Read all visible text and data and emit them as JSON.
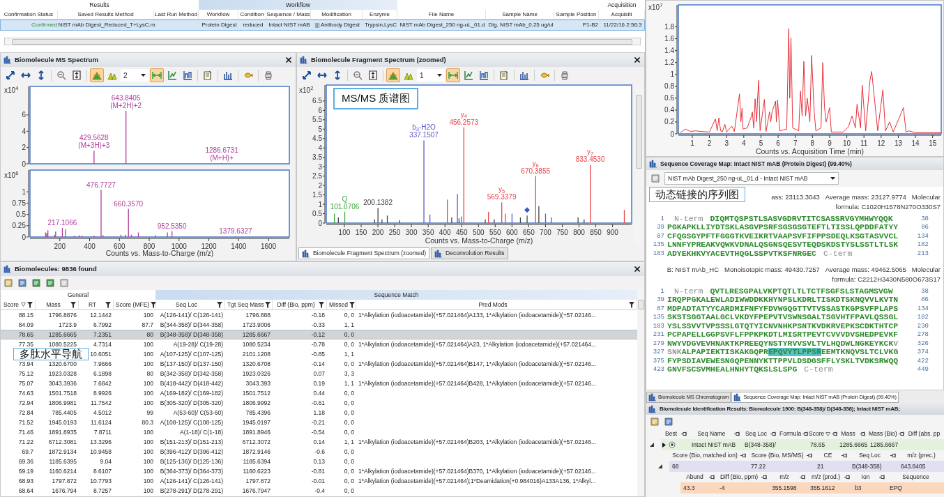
{
  "results_grid": {
    "groups": [
      {
        "label": "Results",
        "kind": "plain"
      },
      {
        "label": "Workflow",
        "kind": "band"
      },
      {
        "label": "Acquisition",
        "kind": "plain"
      }
    ],
    "columns": [
      "Confirmation Status",
      "Saved Results Method",
      "Last Run Method",
      "Workflow",
      "Condition",
      "Sequence / Mass",
      "Modification",
      "Enzyme",
      "File Name",
      "Sample Name",
      "Sample Position",
      "Acquisiti"
    ],
    "rows": [
      {
        "selected": true,
        "cells": [
          "Confirmed",
          "NIST mAb Digest_Reduced_T+LysC.m",
          null,
          "Protein Digest",
          "reduced",
          "Intact NIST mAB",
          "||| Antibody Digest",
          "Trypsin,LysC",
          "NIST mAb Digest_250 ng-uL_01.d",
          "Dig. NIST mAb_0.25 ug/ul",
          "P1-B2",
          "11/22/16 2:56:3"
        ]
      }
    ]
  },
  "ms_panel": {
    "title": "Biomolecule MS Spectrum",
    "toolbar": {
      "buttons": [
        {
          "selected": false
        },
        {
          "selected": false
        },
        {
          "selected": false
        },
        {
          "selected": false
        },
        {
          "selected": false
        },
        {
          "selected": true
        },
        {
          "selected": false
        },
        {
          "selected": true
        },
        {
          "selected": false
        },
        {
          "selected": false
        },
        {
          "selected": false
        },
        {
          "selected": false
        },
        {
          "selected": false
        },
        {
          "selected": false
        }
      ],
      "dropdown": "2"
    },
    "charts": [
      {
        "chart_data": {
          "type": "bar",
          "ylabel": "x10$^{4}$",
          "xlim": [
            0,
            1740
          ],
          "ylim": [
            0,
            9.5
          ],
          "yticks": [
            0,
            2,
            4,
            6
          ],
          "x": [
            429.5628,
            643.8405,
            1286.6731
          ],
          "series": [
            {
              "color": "#b03c9c",
              "values": [
                1.6,
                6.5,
                0.1
              ]
            }
          ],
          "annotations": [
            {
              "x": 643.8405,
              "y": 6.5,
              "text": "643.8405"
            },
            {
              "x": 643.8405,
              "y": 6.5,
              "text": "(M+2H)+2"
            },
            {
              "x": 429.5628,
              "y": 1.6,
              "text": "429.5628"
            },
            {
              "x": 429.5628,
              "y": 1.6,
              "text": "(M+3H)+3"
            },
            {
              "x": 1286.6731,
              "y": 0.1,
              "text": "1286.6731"
            },
            {
              "x": 1286.6731,
              "y": 0.1,
              "text": "(M+H)+"
            }
          ]
        }
      },
      {
        "chart_data": {
          "type": "bar",
          "ylabel": "x10$^{6}$",
          "xlabel": "Counts vs. Mass-to-Charge (m/z)",
          "xlim": [
            0,
            1740
          ],
          "ylim": [
            0,
            1.48
          ],
          "yticks": [
            0,
            0.25,
            0.5,
            0.75,
            1
          ],
          "xticks": [
            200,
            400,
            600,
            800,
            1000,
            1200,
            1400,
            1600
          ],
          "x": [
            105,
            112,
            120,
            165,
            172,
            217.1066,
            238,
            300,
            330,
            350,
            400,
            430,
            476.7727,
            490,
            520,
            610,
            640,
            660.357,
            680,
            727,
            760,
            840,
            922,
            952.535,
            1379.6327
          ],
          "series": [
            {
              "color": "#b03c9c",
              "values": [
                0.1,
                0.08,
                0.15,
                0.05,
                0.12,
                0.2,
                0.17,
                0.03,
                0.04,
                0.03,
                null,
                0.03,
                1.04,
                0.04,
                null,
                0.05,
                0.05,
                0.62,
                0.05,
                0.1,
                null,
                0.04,
                0.1,
                0.13,
                0.01
              ]
            }
          ],
          "annotations": [
            {
              "x": 476.7727,
              "y": 1.04,
              "text": "476.7727"
            },
            {
              "x": 660.357,
              "y": 0.62,
              "text": "660.3570"
            },
            {
              "x": 217.1066,
              "y": 0.2,
              "text": "217.1066"
            },
            {
              "x": 952.535,
              "y": 0.13,
              "text": "952.5350"
            },
            {
              "x": 1379.6327,
              "y": 0.01,
              "text": "1379.6327"
            }
          ]
        }
      }
    ]
  },
  "fragment_panel": {
    "title": "Biomolecule Fragment Spectrum (zoomed)",
    "toolbar": {
      "buttons": [
        {
          "selected": false
        },
        {
          "selected": false
        },
        {
          "selected": false
        },
        {
          "selected": false
        },
        {
          "selected": false
        },
        {
          "selected": true
        },
        {
          "selected": false
        },
        {
          "selected": true
        },
        {
          "selected": false
        },
        {
          "selected": false
        },
        {
          "selected": false
        },
        {
          "selected": false
        },
        {
          "selected": false
        },
        {
          "selected": false
        }
      ],
      "dropdown": "1"
    },
    "callout": "MS/MS 质谱图",
    "chart_data": {
      "type": "bar",
      "ylabel": "x10$^{2}$",
      "xlabel": "Counts vs. Mass-to-Charge (m/z)",
      "xlim": [
        46,
        957
      ],
      "ylim": [
        0,
        7.35
      ],
      "yticks": [
        0,
        0.5,
        1,
        1.5,
        2,
        2.5,
        3,
        3.5,
        4,
        4.5,
        5,
        5.5,
        6,
        6.5
      ],
      "xticks": [
        100,
        150,
        200,
        250,
        300,
        350,
        400,
        450,
        500,
        550,
        600,
        650,
        700,
        750,
        800,
        850,
        900
      ],
      "series": [
        {
          "color": "#3aa63a",
          "x": [
            70,
            101.0706
          ],
          "values": [
            0.5,
            0.6
          ]
        },
        {
          "color": "#444444",
          "x": [
            82,
            190,
            200.1382,
            212,
            228,
            265,
            420,
            442,
            520,
            547,
            625,
            645,
            680,
            797,
            815
          ],
          "values": [
            0.3,
            0.2,
            0.8,
            0.2,
            0.4,
            0.15,
            0.3,
            0.25,
            0.2,
            0.2,
            0.3,
            0.4,
            0.9,
            0.3,
            0.2
          ]
        },
        {
          "color": "#5b5bc8",
          "x": [
            337.1507,
            355,
            437,
            449,
            600,
            700,
            717
          ],
          "values": [
            4.4,
            0.45,
            1.55,
            0.35,
            0.5,
            0.5,
            0.3
          ]
        },
        {
          "color": "#e8434a",
          "x": [
            407,
            456.2573,
            530,
            569.3379,
            580,
            670.3855,
            833.453,
            935
          ],
          "values": [
            1.25,
            5.1,
            0.6,
            1.1,
            0.5,
            2.5,
            3.1,
            0.7
          ]
        }
      ],
      "annotations": [
        {
          "x": 101.0706,
          "y": 0.6,
          "text": "Q"
        },
        {
          "x": 101.0706,
          "y": 0.6,
          "text": "101.0706"
        },
        {
          "x": 200.1382,
          "y": 0.8,
          "text": "200.1382"
        },
        {
          "x": 337.1507,
          "y": 4.4,
          "text": "b$_{3}$-H2O"
        },
        {
          "x": 337.1507,
          "y": 4.4,
          "text": "337.1507"
        },
        {
          "x": 456.2573,
          "y": 5.1,
          "text": "y$_{4}$"
        },
        {
          "x": 456.2573,
          "y": 5.1,
          "text": "456.2573"
        },
        {
          "x": 569.3379,
          "y": 1.1,
          "text": "y$_{5}$"
        },
        {
          "x": 569.3379,
          "y": 1.1,
          "text": "569.3379"
        },
        {
          "x": 670.3855,
          "y": 2.5,
          "text": "y$_{6}$"
        },
        {
          "x": 670.3855,
          "y": 2.5,
          "text": "670.3855"
        },
        {
          "x": 833.453,
          "y": 3.1,
          "text": "y$_{7}$"
        },
        {
          "x": 833.453,
          "y": 3.1,
          "text": "833.4530"
        }
      ]
    },
    "tabs": [
      {
        "label": "Biomolecule Fragment Spectrum (zoomed)",
        "selected": true
      },
      {
        "label": "Deconvolution Results",
        "selected": false
      }
    ]
  },
  "biomolecules": {
    "title": "Biomolecules: 9836 found",
    "callout": "多肽水平导航",
    "groups": [
      {
        "label": "General",
        "kind": "plain"
      },
      {
        "label": "Sequence Match",
        "kind": "band"
      }
    ],
    "columns": [
      {
        "label": "Score",
        "sorted": true
      },
      {
        "label": "Mass",
        "sorted": false
      },
      {
        "label": "RT",
        "sorted": false
      },
      {
        "label": "Score (MFE)",
        "sorted": false
      },
      {
        "label": "Seq Loc",
        "sorted": false
      },
      {
        "label": "Tgt Seq Mass",
        "sorted": false
      },
      {
        "label": "Diff (Bio, ppm)",
        "sorted": false
      },
      {
        "label": "Missed",
        "sorted": false
      },
      {
        "label": "Pred Mods",
        "sorted": false
      }
    ],
    "rows": [
      {
        "selected": false,
        "cells": [
          "88.15",
          "1796.8876",
          "12.1442",
          "100",
          "A(126-141)/ C(126-141)",
          "1796.888",
          "-0.18",
          "0, 0",
          "1*Alkylation (iodoacetamide)(+57.021464)A133, 1*Alkylation (iodoacetamide)(+57.02146..."
        ]
      },
      {
        "selected": false,
        "cells": [
          "84.09",
          "1723.9",
          "6.7992",
          "87.7",
          "B(344-358)/ D(344-358)",
          "1723.9006",
          "-0.33",
          "1, 1",
          null
        ]
      },
      {
        "selected": true,
        "cells": [
          "78.65",
          "1285.6665",
          "7.2351",
          "80",
          "B(348-358)/ D(348-358)",
          "1285.6667",
          "-0.12",
          "0, 0",
          null
        ]
      },
      {
        "selected": false,
        "cells": [
          "77.35",
          "1080.5225",
          "4.7314",
          "100",
          "A(19-28)/ C(19-28)",
          "1080.5234",
          "-0.78",
          "0, 0",
          "1*Alkylation (iodoacetamide)(+57.021464)A23, 1*Alkylation (iodoacetamide)(+57.021464..."
        ]
      },
      {
        "selected": false,
        "cells": [
          null,
          null,
          "10.6051",
          "100",
          "A(107-125)/ C(107-125)",
          "2101.1208",
          "-0.85",
          "1, 1",
          null
        ]
      },
      {
        "selected": false,
        "cells": [
          "73.94",
          "1320.6700",
          "7.9666",
          "100",
          "B(137-150)/ D(137-150)",
          "1320.6708",
          "-0.14",
          "0, 0",
          "1*Alkylation (iodoacetamide)(+57.021464)B147, 1*Alkylation (iodoacetamide)(+57.02146..."
        ]
      },
      {
        "selected": false,
        "cells": [
          "75.12",
          "1923.0328",
          "6.1898",
          "80",
          "B(342-358)/ D(342-358)",
          "1923.0326",
          "0.07",
          "3, 3",
          null
        ]
      },
      {
        "selected": false,
        "cells": [
          "75.07",
          "3043.3936",
          "7.6842",
          "100",
          "B(418-442)/ D(418-442)",
          "3043.393",
          "0.19",
          "1, 1",
          "1*Alkylation (iodoacetamide)(+57.021464)B428, 1*Alkylation (iodoacetamide)(+57.02146..."
        ]
      },
      {
        "selected": false,
        "cells": [
          "74.63",
          "1501.7518",
          "8.9926",
          "100",
          "A(169-182)/ C(169-182)",
          "1501.7512",
          "0.44",
          "0, 0",
          null
        ]
      },
      {
        "selected": false,
        "cells": [
          "72.94",
          "1806.9981",
          "11.7542",
          "100",
          "B(305-320)/ D(305-320)",
          "1806.9992",
          "-0.61",
          "0, 0",
          null
        ]
      },
      {
        "selected": false,
        "cells": [
          "72.84",
          "785.4405",
          "4.5012",
          "99",
          "A(53-60)/ C(53-60)",
          "785.4396",
          "1.18",
          "0, 0",
          null
        ]
      },
      {
        "selected": false,
        "cells": [
          "71.52",
          "1945.0193",
          "11.6124",
          "80.3",
          "A(108-125)/ C(108-125)",
          "1945.0197",
          "-0.21",
          "0, 0",
          null
        ]
      },
      {
        "selected": false,
        "cells": [
          "71.46",
          "1891.8935",
          "7.8711",
          "100",
          "A(1-18)/ C(1-18)",
          "1891.8946",
          "-0.54",
          "0, 0",
          null
        ]
      },
      {
        "selected": false,
        "cells": [
          "71.22",
          "6712.3081",
          "13.3296",
          "100",
          "B(151-213)/ D(151-213)",
          "6712.3072",
          "0.14",
          "1, 1",
          "1*Alkylation (iodoacetamide)(+57.021464)B203, 1*Alkylation (iodoacetamide)(+57.02146..."
        ]
      },
      {
        "selected": false,
        "cells": [
          "69.7",
          "1872.9134",
          "10.9458",
          "100",
          "B(396-412)/ D(396-412)",
          "1872.9146",
          "-0.6",
          "0, 0",
          null
        ]
      },
      {
        "selected": false,
        "cells": [
          "69.36",
          "1185.6395",
          "9.04",
          "100",
          "B(125-136)/ D(125-136)",
          "1185.6394",
          "0.13",
          "0, 0",
          null
        ]
      },
      {
        "selected": false,
        "cells": [
          "69.19",
          "1160.6214",
          "8.6107",
          "100",
          "B(364-373)/ D(364-373)",
          "1160.6223",
          "-0.81",
          "0, 0",
          "1*Alkylation (iodoacetamide)(+57.021464)B370, 1*Alkylation (iodoacetamide)(+57.02146..."
        ]
      },
      {
        "selected": false,
        "cells": [
          "68.93",
          "1797.872",
          "10.7793",
          "100",
          "A(126-141)/ C(126-141)",
          "1797.872",
          "-0.01",
          "0, 0",
          "1*Alkylation (iodoacetamide)(+57.021464);1*Deamidation(+0.984016)A133A136, 1*Alkyl..."
        ]
      },
      {
        "selected": false,
        "cells": [
          "68.64",
          "1676.794",
          "8.7257",
          "100",
          "B(278-291)/ D(278-291)",
          "1676.7947",
          "-0.4",
          "0, 0",
          null
        ]
      }
    ]
  },
  "chromatogram": {
    "chart_data": {
      "type": "line",
      "ylabel": "x10$^{7}$",
      "xlabel": "Counts vs. Acquisition Time (min)",
      "xlim": [
        0.19,
        15.5
      ],
      "ylim": [
        0,
        2.17
      ],
      "yticks": [
        0,
        0.2,
        0.4,
        0.6,
        0.8,
        1,
        1.2,
        1.4,
        1.6,
        1.8
      ],
      "xticks": [
        1,
        2,
        3,
        4,
        5,
        6,
        7,
        8,
        9,
        10,
        11,
        12,
        13,
        14,
        15
      ],
      "x": [
        0.3,
        0.6,
        0.9,
        1.2,
        1.5,
        2.0,
        2.35,
        2.45,
        2.55,
        2.65,
        2.75,
        2.9,
        3.0,
        3.3,
        3.45,
        3.75,
        3.83,
        3.9,
        3.95,
        4.2,
        4.45,
        4.5,
        4.58,
        4.66,
        4.75,
        4.8,
        4.87,
        4.95,
        5.2,
        5.3,
        5.5,
        5.57,
        5.65,
        5.85,
        5.9,
        5.97,
        6.1,
        6.5,
        6.62,
        6.68,
        6.75,
        6.85,
        7.2,
        7.3,
        7.4,
        7.5,
        7.6,
        7.7,
        7.85,
        7.95,
        8.1,
        8.2,
        8.5,
        8.6,
        8.7,
        8.8,
        9.0,
        9.1,
        9.8,
        10.1,
        10.3,
        10.5,
        10.6,
        10.8,
        10.9,
        11.1,
        11.35,
        11.45,
        11.8,
        12.1,
        12.25,
        12.5,
        12.7,
        13.3,
        13.45,
        13.6,
        14.0,
        15.5
      ],
      "series": [
        {
          "color": "#e8303a",
          "values": [
            0.02,
            0.08,
            0.04,
            0.05,
            0.04,
            0.03,
            0.25,
            0.05,
            0.27,
            0.05,
            0.03,
            0.16,
            0.03,
            0.13,
            0.04,
            0.67,
            0.2,
            0.43,
            0.08,
            0.1,
            0.3,
            0.37,
            0.1,
            0.59,
            0.2,
            0.57,
            0.9,
            0.05,
            0.58,
            0.04,
            0.37,
            0.2,
            0.37,
            0.55,
            0.2,
            0.57,
            0.05,
            0.08,
            1.77,
            0.6,
            1.62,
            0.1,
            0.05,
            0.72,
            0.3,
            1.22,
            0.3,
            0.6,
            0.2,
            1.32,
            0.37,
            0.05,
            0.1,
            1.2,
            0.45,
            0.2,
            0.44,
            0.03,
            0.03,
            0.12,
            0.3,
            0.1,
            0.5,
            0.1,
            0.82,
            0.05,
            0.9,
            1.05,
            0.05,
            0.74,
            0.05,
            0.2,
            0.03,
            0.44,
            0.03,
            0.05,
            0.02,
            0.02
          ]
        }
      ]
    }
  },
  "coverage": {
    "title": "Sequence Coverage Map: Intact NIST mAB (Protein Digest) (99.40%)",
    "dropdown": "NIST mAb Digest_250 ng-uL_01.d - Intact NIST mAB",
    "chains": [
      {
        "callout": "动态链接的序列图",
        "mono_mass": "ass: 23113.3043",
        "average_mass": "Average mass: 23127.9774",
        "molecular": "Molecular",
        "formula": "formula: C1020H1578N270O330S7",
        "lines": [
          {
            "start": "1",
            "end": "38",
            "segments": [
              {
                "kind": "term",
                "text": "N-term"
              },
              {
                "kind": "covered",
                "text": "DIQMTQSPSTLSASVGDRVTITCSASSRVGYMHWYQQK"
              }
            ]
          },
          {
            "start": "39",
            "end": "86",
            "segments": [
              {
                "kind": "covered",
                "text": "PGKAPKLLIYDTSKLASGVPSRFSGSGSGTEFTLTISSLQPDDFATYY"
              }
            ]
          },
          {
            "start": "87",
            "end": "134",
            "segments": [
              {
                "kind": "covered",
                "text": "CFQGSGYPFTFGGGTKVEIKRTVAAPSVFIFPPSDEQLKSGTASVVCL"
              }
            ]
          },
          {
            "start": "135",
            "end": "182",
            "segments": [
              {
                "kind": "covered",
                "text": "LNNFYPREAKVQWKVDNALQSGNSQESVTEQDSKDSTYSLSSTLTLSK"
              }
            ]
          },
          {
            "start": "183",
            "end": "213",
            "segments": [
              {
                "kind": "covered",
                "text": "ADYEKHKVYACEVTHQGLSSPVTKSFNRGEC"
              },
              {
                "kind": "term",
                "text": "C-term"
              }
            ]
          }
        ]
      },
      {
        "label": "B: NIST mAb_HC",
        "mono_mass": "Monoisotopic mass: 49430.7257",
        "average_mass": "Average mass: 49462.5065",
        "molecular": "Molecular",
        "formula": "formula: C2212H3430N580O673S17",
        "lines": [
          {
            "start": "1",
            "end": "38",
            "segments": [
              {
                "kind": "term",
                "text": "N-term"
              },
              {
                "kind": "covered",
                "text": "QVTLRESGPALVKPTQTLTLTCTFSGFSLSTAGMSVGW"
              }
            ]
          },
          {
            "start": "39",
            "end": "86",
            "segments": [
              {
                "kind": "covered",
                "text": "IRQPPGKALEWLADIWWDDKKHYNPSLKDRLTISKDTSKNQVVLKVTN"
              }
            ]
          },
          {
            "start": "87",
            "end": "134",
            "segments": [
              {
                "kind": "covered",
                "text": "MDPADTATYYCARDMIFNFYFDVWGQGTTVTVSSASTKGPSVFPLAPS"
              }
            ]
          },
          {
            "start": "135",
            "end": "182",
            "segments": [
              {
                "kind": "covered",
                "text": "SKSTSGGTAALGCLVKDYFPEPVTVSWNSGALTSGVHTFPAVLQSSGL"
              }
            ]
          },
          {
            "start": "183",
            "end": "230",
            "segments": [
              {
                "kind": "covered",
                "text": "YSLSSVVTVPSSSLGTQTYICNVNHKPSNTKVDKRVEPKSCDKTHTCP"
              }
            ]
          },
          {
            "start": "231",
            "end": "278",
            "segments": [
              {
                "kind": "covered",
                "text": "PCPAPELLGGPSVFLFPPKPKDTLMISRTPEVTCVVVDVSHEDPEVKF"
              }
            ]
          },
          {
            "start": "279",
            "end": "326",
            "segments": [
              {
                "kind": "covered",
                "text": "NWYVDGVEVHNAKTKPREEQYNSTYRVVSVLTVLHQDWLNGKEYKCK"
              },
              {
                "kind": "uncovered",
                "text": "V"
              }
            ]
          },
          {
            "start": "327",
            "end": "374",
            "segments": [
              {
                "kind": "uncovered",
                "text": "SNK"
              },
              {
                "kind": "covered",
                "text": "ALPAPIEKTISKAKGQPR"
              },
              {
                "kind": "highlight",
                "text": "EPQVYTLPPSR"
              },
              {
                "kind": "covered",
                "text": "EEMTKNQVSLTCLVKG"
              }
            ]
          },
          {
            "start": "375",
            "end": "422",
            "segments": [
              {
                "kind": "covered",
                "text": "FYPSDIAVEWESNGQPENNYKTTPPVLDSDGSFFLYSKLTVDKSRWQQ"
              }
            ]
          },
          {
            "start": "423",
            "end": "449",
            "segments": [
              {
                "kind": "covered",
                "text": "GNVFSCSVMHEALHNHYTQKSLSLSPG"
              },
              {
                "kind": "term",
                "text": "C-term"
              }
            ]
          }
        ]
      }
    ]
  },
  "bottom_tabs": [
    {
      "label": "Biomolecule MS Chromatogram",
      "selected": false
    },
    {
      "label": "Sequence Coverage Map: Intact NIST mAB (Protein Digest) (99.40%)",
      "selected": true
    }
  ],
  "id_results": {
    "title": "Biomolecule Identification Results: Biomolecule 1900: B(348-358)/ D(348-358); Intact NIST mAB;",
    "levels": [
      {
        "columns": [
          {
            "label": "Best",
            "sorted": false
          },
          {
            "label": "Seq Name",
            "sorted": false
          },
          {
            "label": "Seq Loc",
            "sorted": false
          },
          {
            "label": "Formula",
            "sorted": false
          },
          {
            "label": "Score",
            "sorted": true
          },
          {
            "label": "Mass",
            "sorted": false
          },
          {
            "label": "Mass (Bio)",
            "sorted": false
          },
          {
            "label": "Diff (abs. pp",
            "sorted": false
          }
        ],
        "rows": [
          {
            "expanded": true,
            "best": true,
            "cells": [
              "",
              "Intact NIST mAB",
              "B(348-358)/",
              "",
              "78.65",
              "1285.6665",
              "1285.6667",
              ""
            ]
          }
        ]
      },
      {
        "columns": [
          {
            "label": "Score (Bio, matched ion)",
            "sorted": false
          },
          {
            "label": "Score (Bio, MS/MS)",
            "sorted": false
          },
          {
            "label": "CE",
            "sorted": false
          },
          {
            "label": "Seq Loc",
            "sorted": false
          },
          {
            "label": "m/z (prec.)",
            "sorted": false
          }
        ],
        "rows": [
          {
            "expanded": true,
            "cells": [
              "68",
              "77.22",
              "21",
              "B(348-358)",
              "643.8405"
            ]
          }
        ]
      },
      {
        "columns": [
          {
            "label": "Abund",
            "sorted": false
          },
          {
            "label": "Diff (Bio, ppm)",
            "sorted": false
          },
          {
            "label": "m/z",
            "sorted": false
          },
          {
            "label": "m/z (prod.)",
            "sorted": false
          },
          {
            "label": "Ion",
            "sorted": false
          },
          {
            "label": "Sequence",
            "sorted": false
          }
        ],
        "rows": [
          {
            "cells": [
              "43.3",
              "-4",
              "355.1598",
              "355.1612",
              "b3",
              "EPQ"
            ]
          }
        ]
      }
    ]
  }
}
